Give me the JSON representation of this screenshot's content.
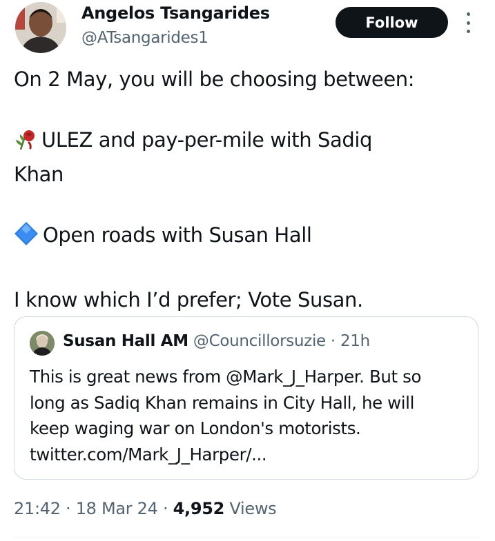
{
  "author": {
    "name": "Angelos Tsangarides",
    "handle": "@ATsangarides1",
    "avatar_icon": "profile-photo"
  },
  "follow_label": "Follow",
  "more_icon": "more-options-icon",
  "tweet": {
    "line1": "On 2 May, you will be choosing between:",
    "option1_line1": "ULEZ and pay-per-mile with Sadiq",
    "option1_line2": "Khan",
    "option1_icon": "wilted-rose-icon",
    "option2": "Open roads with Susan Hall",
    "option2_icon": "blue-diamond-icon",
    "closing": "I know which I’d prefer; Vote Susan."
  },
  "quote": {
    "name": "Susan Hall AM",
    "handle": "@Councillorsuzie",
    "time": "· 21h",
    "lines": [
      "This is great news from @Mark_J_Harper. But so",
      "long as Sadiq Khan remains in City Hall, he will",
      "keep waging war on London's motorists.",
      "twitter.com/Mark_J_Harper/..."
    ]
  },
  "footer": {
    "time": "21:42",
    "sep1": "·",
    "date": "18 Mar 24",
    "sep2": "·",
    "views_count": "4,952",
    "views_label": "Views"
  },
  "colors": {
    "text": "#0f1419",
    "secondary": "#536471",
    "border": "#cfd9de",
    "button": "#0f1419"
  }
}
